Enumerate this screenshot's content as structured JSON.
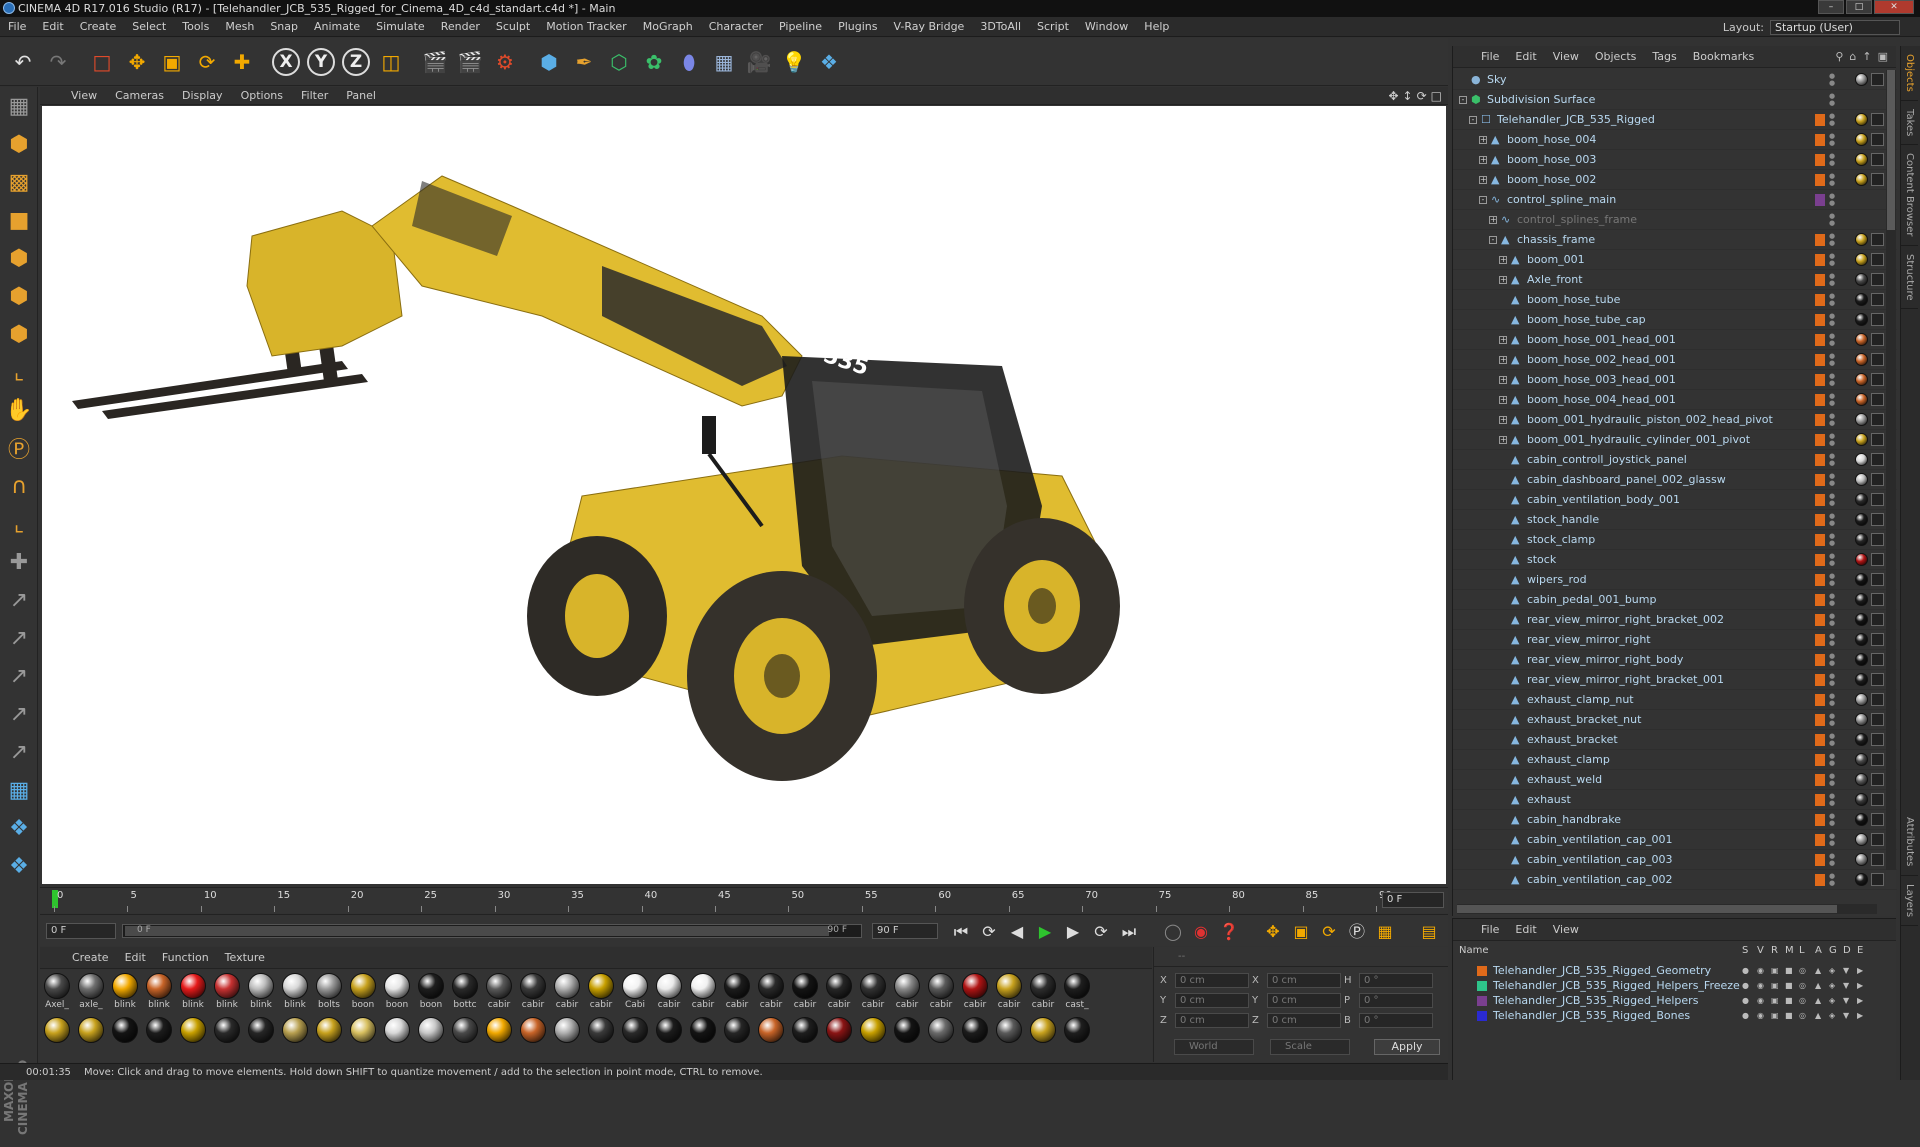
{
  "window": {
    "title": "CINEMA 4D R17.016 Studio (R17) - [Telehandler_JCB_535_Rigged_for_Cinema_4D_c4d_standart.c4d *] - Main"
  },
  "menu": [
    "File",
    "Edit",
    "Create",
    "Select",
    "Tools",
    "Mesh",
    "Snap",
    "Animate",
    "Simulate",
    "Render",
    "Sculpt",
    "Motion Tracker",
    "MoGraph",
    "Character",
    "Pipeline",
    "Plugins",
    "V-Ray Bridge",
    "3DToAll",
    "Script",
    "Window",
    "Help"
  ],
  "layout": {
    "label": "Layout:",
    "value": "Startup (User)"
  },
  "toolbar": {
    "icons": [
      "undo-icon",
      "redo-icon",
      "live-selection-icon",
      "move-icon",
      "scale-icon",
      "rotate-icon",
      "recent-tool-icon",
      "x-axis-icon",
      "y-axis-icon",
      "z-axis-icon",
      "coordinate-system-icon",
      "render-view-icon",
      "render-picture-viewer-icon",
      "edit-render-settings-icon",
      "cube-icon",
      "pen-spline-icon",
      "subdivision-icon",
      "array-icon",
      "deformer-icon",
      "floor-icon",
      "camera-icon",
      "light-icon",
      "python-icon"
    ],
    "axis_x": "X",
    "axis_y": "Y",
    "axis_z": "Z"
  },
  "viewport": {
    "menu": [
      "View",
      "Cameras",
      "Display",
      "Options",
      "Filter",
      "Panel"
    ]
  },
  "timeline": {
    "ticks": [
      "0",
      "5",
      "10",
      "15",
      "20",
      "25",
      "30",
      "35",
      "40",
      "45",
      "50",
      "55",
      "60",
      "65",
      "70",
      "75",
      "80",
      "85",
      "90"
    ],
    "current": "0 F"
  },
  "transport": {
    "start": "0 F",
    "range_start": "0 F",
    "range_end": "90 F",
    "end": "90 F"
  },
  "material_manager": {
    "menu": [
      "Create",
      "Edit",
      "Function",
      "Texture"
    ],
    "row1": [
      {
        "name": "Axel_",
        "color": "#4a4a4a"
      },
      {
        "name": "axle_",
        "color": "#6e6e6e"
      },
      {
        "name": "blink",
        "color": "#f2a900"
      },
      {
        "name": "blink",
        "color": "#c86428"
      },
      {
        "name": "blink",
        "color": "#e61a1a"
      },
      {
        "name": "blink",
        "color": "#c83232"
      },
      {
        "name": "blink",
        "color": "#bdbdbd"
      },
      {
        "name": "blink",
        "color": "#d8d8d8"
      },
      {
        "name": "bolts",
        "color": "#9a9a9a"
      },
      {
        "name": "boon",
        "color": "#c8a21e"
      },
      {
        "name": "boon",
        "color": "#e6e6e6"
      },
      {
        "name": "boon",
        "color": "#1e1e1e"
      },
      {
        "name": "bottc",
        "color": "#2a2a2a"
      },
      {
        "name": "cabir",
        "color": "#5a5a5a"
      },
      {
        "name": "cabir",
        "color": "#3a3a3a"
      },
      {
        "name": "cabir",
        "color": "#b0b0b0"
      },
      {
        "name": "cabir",
        "color": "#c8a000"
      },
      {
        "name": "Cabi",
        "color": "#f2f2f2"
      },
      {
        "name": "cabir",
        "color": "#eaeaea"
      },
      {
        "name": "cabir",
        "color": "#f0f0f0"
      },
      {
        "name": "cabir",
        "color": "#1c1c1c"
      },
      {
        "name": "cabir",
        "color": "#2a2a2a"
      },
      {
        "name": "cabir",
        "color": "#141414"
      },
      {
        "name": "cabir",
        "color": "#262626"
      },
      {
        "name": "cabir",
        "color": "#333333"
      },
      {
        "name": "cabir",
        "color": "#8a8a8a"
      },
      {
        "name": "cabir",
        "color": "#5a5a5a"
      },
      {
        "name": "cabir",
        "color": "#b01414"
      },
      {
        "name": "cabir",
        "color": "#c8a21e"
      },
      {
        "name": "cabir",
        "color": "#2e2e2e"
      },
      {
        "name": "cast_",
        "color": "#1e1e1e"
      }
    ],
    "row2": [
      {
        "name": "",
        "color": "#c8a21e"
      },
      {
        "name": "",
        "color": "#c8a21e"
      },
      {
        "name": "",
        "color": "#141414"
      },
      {
        "name": "",
        "color": "#1c1c1c"
      },
      {
        "name": "",
        "color": "#c8a000"
      },
      {
        "name": "",
        "color": "#2a2a2a"
      },
      {
        "name": "",
        "color": "#262626"
      },
      {
        "name": "",
        "color": "#b8a050"
      },
      {
        "name": "",
        "color": "#c8a21e"
      },
      {
        "name": "",
        "color": "#d8c060"
      },
      {
        "name": "",
        "color": "#d8d8d8"
      },
      {
        "name": "",
        "color": "#c8c8c8"
      },
      {
        "name": "",
        "color": "#4a4a4a"
      },
      {
        "name": "",
        "color": "#f2a900"
      },
      {
        "name": "",
        "color": "#c86428"
      },
      {
        "name": "",
        "color": "#b0b0b0"
      },
      {
        "name": "",
        "color": "#3a3a3a"
      },
      {
        "name": "",
        "color": "#2a2a2a"
      },
      {
        "name": "",
        "color": "#1c1c1c"
      },
      {
        "name": "",
        "color": "#141414"
      },
      {
        "name": "",
        "color": "#262626"
      },
      {
        "name": "",
        "color": "#c86428"
      },
      {
        "name": "",
        "color": "#1e1e1e"
      },
      {
        "name": "",
        "color": "#8a1414"
      },
      {
        "name": "",
        "color": "#c8a000"
      },
      {
        "name": "",
        "color": "#141414"
      },
      {
        "name": "",
        "color": "#6a6a6a"
      },
      {
        "name": "",
        "color": "#1c1c1c"
      },
      {
        "name": "",
        "color": "#5a5a5a"
      },
      {
        "name": "",
        "color": "#c8a21e"
      },
      {
        "name": "",
        "color": "#1e1e1e"
      }
    ]
  },
  "coordinates": {
    "header": "--",
    "x_pos": "0 cm",
    "y_pos": "0 cm",
    "z_pos": "0 cm",
    "x_size": "0 cm",
    "y_size": "0 cm",
    "z_size": "0 cm",
    "h": "0 °",
    "p": "0 °",
    "b": "0 °",
    "labels": {
      "x": "X",
      "y": "Y",
      "z": "Z",
      "h": "H",
      "p": "P",
      "b": "B"
    },
    "mode": "World",
    "size_mode": "Scale",
    "apply": "Apply"
  },
  "status": {
    "time": "00:01:35",
    "message": "Move: Click and drag to move elements. Hold down SHIFT to quantize movement / add to the selection in point mode, CTRL to remove."
  },
  "object_manager": {
    "menu": [
      "File",
      "Edit",
      "View",
      "Objects",
      "Tags",
      "Bookmarks"
    ],
    "objects": [
      {
        "name": "Sky",
        "level": 0,
        "exp": "",
        "icon": "sky",
        "dim": false,
        "tag": "#9a9a9a",
        "vis": "none"
      },
      {
        "name": "Subdivision Surface",
        "level": 0,
        "exp": "-",
        "icon": "subdiv",
        "dim": false,
        "tag": "",
        "vis": "none"
      },
      {
        "name": "Telehandler_JCB_535_Rigged",
        "level": 1,
        "exp": "-",
        "icon": "null",
        "dim": false,
        "tag": "#c8a21e",
        "vis": "orange"
      },
      {
        "name": "boom_hose_004",
        "level": 2,
        "exp": "+",
        "icon": "poly",
        "dim": false,
        "tag": "#c8a21e",
        "vis": "orange"
      },
      {
        "name": "boom_hose_003",
        "level": 2,
        "exp": "+",
        "icon": "poly",
        "dim": false,
        "tag": "#c8a21e",
        "vis": "orange"
      },
      {
        "name": "boom_hose_002",
        "level": 2,
        "exp": "+",
        "icon": "poly",
        "dim": false,
        "tag": "#c8a21e",
        "vis": "orange"
      },
      {
        "name": "control_spline_main",
        "level": 2,
        "exp": "-",
        "icon": "spline",
        "dim": false,
        "tag": "",
        "vis": "purple"
      },
      {
        "name": "control_splines_frame",
        "level": 3,
        "exp": "+",
        "icon": "spline",
        "dim": true,
        "tag": "",
        "vis": "none"
      },
      {
        "name": "chassis_frame",
        "level": 3,
        "exp": "-",
        "icon": "poly",
        "dim": false,
        "tag": "#c8a21e",
        "vis": "orange"
      },
      {
        "name": "boom_001",
        "level": 4,
        "exp": "+",
        "icon": "poly",
        "dim": false,
        "tag": "#c8a21e",
        "vis": "orange"
      },
      {
        "name": "Axle_front",
        "level": 4,
        "exp": "+",
        "icon": "poly",
        "dim": false,
        "tag": "#4a4a4a",
        "vis": "orange"
      },
      {
        "name": "boom_hose_tube",
        "level": 4,
        "exp": "",
        "icon": "poly",
        "dim": false,
        "tag": "#1c1c1c",
        "vis": "orange"
      },
      {
        "name": "boom_hose_tube_cap",
        "level": 4,
        "exp": "",
        "icon": "poly",
        "dim": false,
        "tag": "#1c1c1c",
        "vis": "orange"
      },
      {
        "name": "boom_hose_001_head_001",
        "level": 4,
        "exp": "+",
        "icon": "poly",
        "dim": false,
        "tag": "#c86428",
        "vis": "orange"
      },
      {
        "name": "boom_hose_002_head_001",
        "level": 4,
        "exp": "+",
        "icon": "poly",
        "dim": false,
        "tag": "#c86428",
        "vis": "orange"
      },
      {
        "name": "boom_hose_003_head_001",
        "level": 4,
        "exp": "+",
        "icon": "poly",
        "dim": false,
        "tag": "#c86428",
        "vis": "orange"
      },
      {
        "name": "boom_hose_004_head_001",
        "level": 4,
        "exp": "+",
        "icon": "poly",
        "dim": false,
        "tag": "#c86428",
        "vis": "orange"
      },
      {
        "name": "boom_001_hydraulic_piston_002_head_pivot",
        "level": 4,
        "exp": "+",
        "icon": "poly",
        "dim": false,
        "tag": "#9a9a9a",
        "vis": "orange"
      },
      {
        "name": "boom_001_hydraulic_cylinder_001_pivot",
        "level": 4,
        "exp": "+",
        "icon": "poly",
        "dim": false,
        "tag": "#c8a21e",
        "vis": "orange"
      },
      {
        "name": "cabin_controll_joystick_panel",
        "level": 4,
        "exp": "",
        "icon": "poly",
        "dim": false,
        "tag": "#d8d8d8",
        "vis": "orange"
      },
      {
        "name": "cabin_dashboard_panel_002_glassw",
        "level": 4,
        "exp": "",
        "icon": "poly",
        "dim": false,
        "tag": "#bdbdbd",
        "vis": "orange"
      },
      {
        "name": "cabin_ventilation_body_001",
        "level": 4,
        "exp": "",
        "icon": "poly",
        "dim": false,
        "tag": "#2a2a2a",
        "vis": "orange"
      },
      {
        "name": "stock_handle",
        "level": 4,
        "exp": "",
        "icon": "poly",
        "dim": false,
        "tag": "#1c1c1c",
        "vis": "orange"
      },
      {
        "name": "stock_clamp",
        "level": 4,
        "exp": "",
        "icon": "poly",
        "dim": false,
        "tag": "#262626",
        "vis": "orange"
      },
      {
        "name": "stock",
        "level": 4,
        "exp": "",
        "icon": "poly",
        "dim": false,
        "tag": "#b01414",
        "vis": "orange"
      },
      {
        "name": "wipers_rod",
        "level": 4,
        "exp": "",
        "icon": "poly",
        "dim": false,
        "tag": "#141414",
        "vis": "orange"
      },
      {
        "name": "cabin_pedal_001_bump",
        "level": 4,
        "exp": "",
        "icon": "poly",
        "dim": false,
        "tag": "#1c1c1c",
        "vis": "orange"
      },
      {
        "name": "rear_view_mirror_right_bracket_002",
        "level": 4,
        "exp": "",
        "icon": "poly",
        "dim": false,
        "tag": "#141414",
        "vis": "orange"
      },
      {
        "name": "rear_view_mirror_right",
        "level": 4,
        "exp": "",
        "icon": "poly",
        "dim": false,
        "tag": "#1c1c1c",
        "vis": "orange"
      },
      {
        "name": "rear_view_mirror_right_body",
        "level": 4,
        "exp": "",
        "icon": "poly",
        "dim": false,
        "tag": "#141414",
        "vis": "orange"
      },
      {
        "name": "rear_view_mirror_right_bracket_001",
        "level": 4,
        "exp": "",
        "icon": "poly",
        "dim": false,
        "tag": "#1c1c1c",
        "vis": "orange"
      },
      {
        "name": "exhaust_clamp_nut",
        "level": 4,
        "exp": "",
        "icon": "poly",
        "dim": false,
        "tag": "#9a9a9a",
        "vis": "orange"
      },
      {
        "name": "exhaust_bracket_nut",
        "level": 4,
        "exp": "",
        "icon": "poly",
        "dim": false,
        "tag": "#8a8a8a",
        "vis": "orange"
      },
      {
        "name": "exhaust_bracket",
        "level": 4,
        "exp": "",
        "icon": "poly",
        "dim": false,
        "tag": "#1e1e1e",
        "vis": "orange"
      },
      {
        "name": "exhaust_clamp",
        "level": 4,
        "exp": "",
        "icon": "poly",
        "dim": false,
        "tag": "#4a4a4a",
        "vis": "orange"
      },
      {
        "name": "exhaust_weld",
        "level": 4,
        "exp": "",
        "icon": "poly",
        "dim": false,
        "tag": "#5a5a5a",
        "vis": "orange"
      },
      {
        "name": "exhaust",
        "level": 4,
        "exp": "",
        "icon": "poly",
        "dim": false,
        "tag": "#3a3a3a",
        "vis": "orange"
      },
      {
        "name": "cabin_handbrake",
        "level": 4,
        "exp": "",
        "icon": "poly",
        "dim": false,
        "tag": "#141414",
        "vis": "orange"
      },
      {
        "name": "cabin_ventilation_cap_001",
        "level": 4,
        "exp": "",
        "icon": "poly",
        "dim": false,
        "tag": "#9a9a9a",
        "vis": "orange"
      },
      {
        "name": "cabin_ventilation_cap_003",
        "level": 4,
        "exp": "",
        "icon": "poly",
        "dim": false,
        "tag": "#8a8a8a",
        "vis": "orange"
      },
      {
        "name": "cabin_ventilation_cap_002",
        "level": 4,
        "exp": "",
        "icon": "poly",
        "dim": false,
        "tag": "#1c1c1c",
        "vis": "orange"
      }
    ]
  },
  "layer_manager": {
    "menu": [
      "File",
      "Edit",
      "View"
    ],
    "columns": [
      "Name",
      "S",
      "V",
      "R",
      "M",
      "L",
      "A",
      "G",
      "D",
      "E"
    ],
    "layers": [
      {
        "name": "Telehandler_JCB_535_Rigged_Geometry",
        "color": "#e06a1a"
      },
      {
        "name": "Telehandler_JCB_535_Rigged_Helpers_Freeze",
        "color": "#2ec48a"
      },
      {
        "name": "Telehandler_JCB_535_Rigged_Helpers",
        "color": "#7a3f8f"
      },
      {
        "name": "Telehandler_JCB_535_Rigged_Bones",
        "color": "#2a2ad0"
      }
    ]
  },
  "right_tabs": [
    "Objects",
    "Takes",
    "Content Browser",
    "Structure",
    "Attributes",
    "Layers"
  ]
}
